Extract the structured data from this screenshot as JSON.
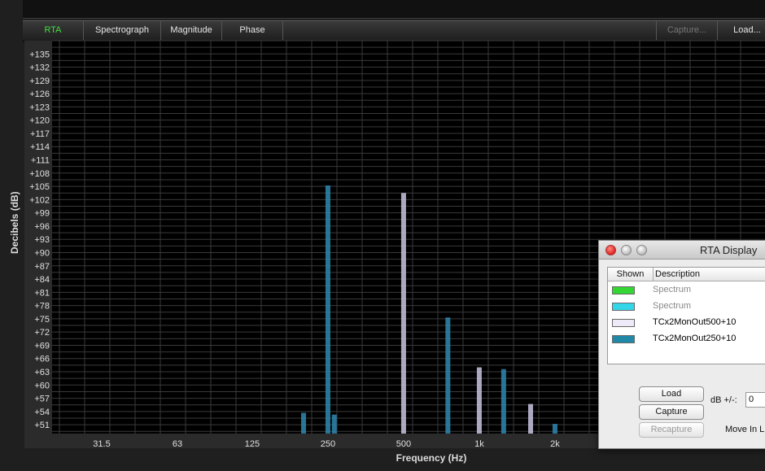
{
  "tabs": [
    {
      "label": "RTA",
      "active": true
    },
    {
      "label": "Spectrograph"
    },
    {
      "label": "Magnitude"
    },
    {
      "label": "Phase"
    },
    {
      "label": "Capture...",
      "disabled": true
    },
    {
      "label": "Load..."
    }
  ],
  "chart_data": {
    "type": "bar",
    "xlabel": "Frequency (Hz)",
    "ylabel": "Decibels (dB)",
    "x_scale": "log",
    "y_ticks": [
      "+51",
      "+54",
      "+57",
      "+60",
      "+63",
      "+66",
      "+69",
      "+72",
      "+75",
      "+78",
      "+81",
      "+84",
      "+87",
      "+90",
      "+93",
      "+96",
      "+99",
      "+102",
      "+105",
      "+108",
      "+111",
      "+114",
      "+117",
      "+120",
      "+123",
      "+126",
      "+129",
      "+132",
      "+135"
    ],
    "x_ticks": [
      "31.5",
      "63",
      "125",
      "250",
      "500",
      "1k",
      "2k"
    ],
    "ylim": [
      49,
      138
    ],
    "grid": true,
    "series": [
      {
        "name": "TCx2MonOut250+10",
        "color": "#2f88b0",
        "points": [
          [
            200,
            53.7
          ],
          [
            250,
            105.2
          ],
          [
            265,
            53.3
          ],
          [
            750,
            75.3
          ],
          [
            1250,
            63.6
          ],
          [
            2000,
            51.2
          ]
        ]
      },
      {
        "name": "TCx2MonOut500+10",
        "color": "#c8c4e0",
        "points": [
          [
            500,
            103.5
          ],
          [
            1000,
            64.0
          ],
          [
            1600,
            55.7
          ]
        ]
      }
    ]
  },
  "rta_display": {
    "title": "RTA Display",
    "columns": {
      "shown": "Shown",
      "description": "Description"
    },
    "items": [
      {
        "description": "Spectrum",
        "color": "#33d633",
        "dim": true
      },
      {
        "description": "Spectrum",
        "color": "#33d6e8",
        "dim": true
      },
      {
        "description": "TCx2MonOut500+10",
        "color": "#eeeaf8",
        "dim": false
      },
      {
        "description": "TCx2MonOut250+10",
        "color": "#2189a8",
        "dim": false
      }
    ],
    "load_label": "Load",
    "capture_label": "Capture",
    "recapture_label": "Recapture",
    "db_label": "dB +/-:",
    "db_value": "0",
    "move_label": "Move In L"
  }
}
